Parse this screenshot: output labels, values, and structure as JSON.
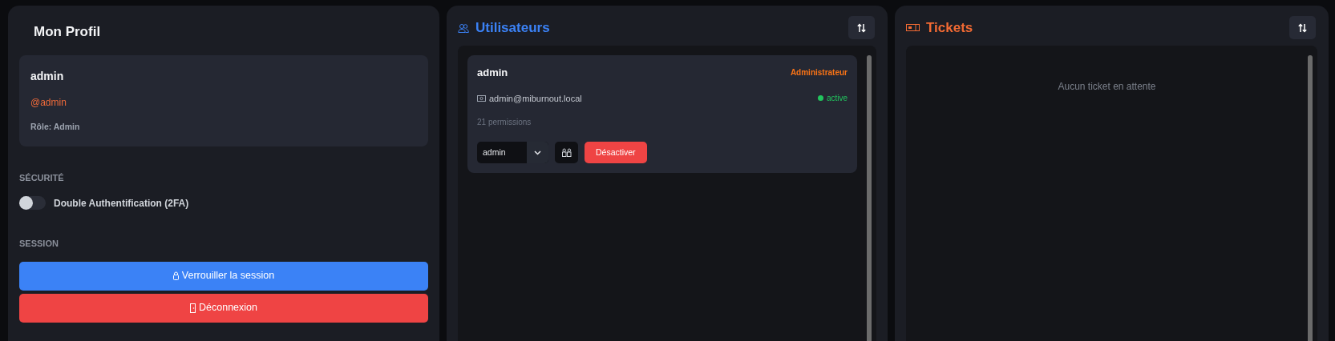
{
  "profile": {
    "title": "Mon Profil",
    "name": "admin",
    "handle": "@admin",
    "role": "Rôle: Admin",
    "security_heading": "SÉCURITÉ",
    "two_factor": {
      "label": "Double Authentification (2FA)",
      "on": false
    },
    "session_heading": "SESSION",
    "buttons": [
      {
        "label": "Verrouiller la session",
        "kind": "lock"
      },
      {
        "label": "Déconnexion",
        "kind": "logout"
      }
    ]
  },
  "users": {
    "title": "Utilisateurs",
    "items": [
      {
        "name": "admin",
        "role": "Administrateur",
        "email": "admin@miburnout.local",
        "status": "active",
        "color": "#22c55e",
        "permissions": "21 permissions",
        "role_value": "admin",
        "action": "Désactiver"
      }
    ]
  },
  "tickets": {
    "title": "Tickets",
    "empty": "Aucun ticket en attente"
  }
}
